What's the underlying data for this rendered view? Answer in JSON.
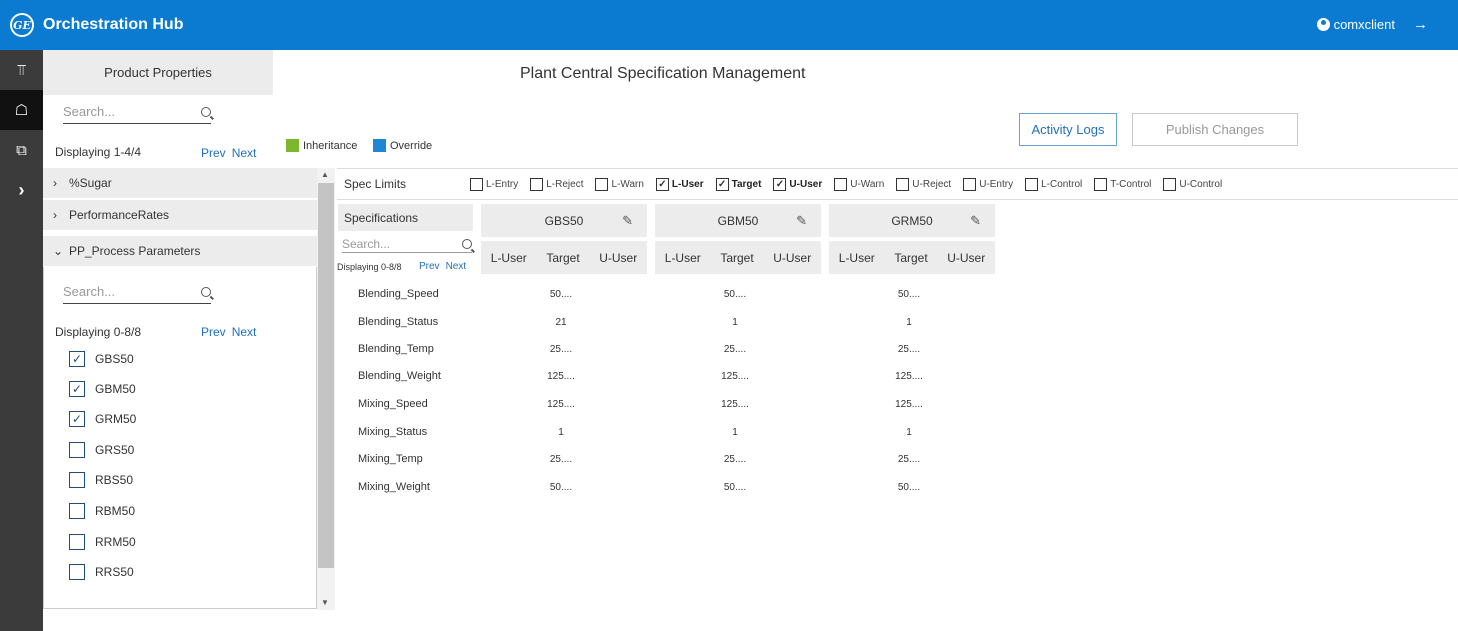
{
  "app": {
    "logo": "GE",
    "title": "Orchestration Hub",
    "user": "comxclient"
  },
  "rail": [
    "hierarchy-icon",
    "factory-icon",
    "grid-icon",
    "chevron-right-icon"
  ],
  "left_panel": {
    "header": "Product Properties",
    "search_placeholder": "Search...",
    "displaying": "Displaying 1-4/4",
    "prev": "Prev",
    "next": "Next",
    "accordion": [
      "%Sugar",
      "PerformanceRates",
      "PP_Process Parameters"
    ],
    "inner_search_placeholder": "Search...",
    "inner_displaying": "Displaying 0-8/8",
    "items": [
      {
        "label": "GBS50",
        "checked": true
      },
      {
        "label": "GBM50",
        "checked": true
      },
      {
        "label": "GRM50",
        "checked": true
      },
      {
        "label": "GRS50",
        "checked": false
      },
      {
        "label": "RBS50",
        "checked": false
      },
      {
        "label": "RBM50",
        "checked": false
      },
      {
        "label": "RRM50",
        "checked": false
      },
      {
        "label": "RRS50",
        "checked": false
      }
    ]
  },
  "main": {
    "title": "Plant Central Specification Management",
    "activity_logs": "Activity Logs",
    "publish_changes": "Publish Changes",
    "legend": [
      {
        "label": "Inheritance",
        "color": "#7cb82f"
      },
      {
        "label": "Override",
        "color": "#1f86d3"
      }
    ],
    "spec_limits_label": "Spec Limits",
    "spec_limits": [
      {
        "label": "L-Entry",
        "checked": false
      },
      {
        "label": "L-Reject",
        "checked": false
      },
      {
        "label": "L-Warn",
        "checked": false
      },
      {
        "label": "L-User",
        "checked": true
      },
      {
        "label": "Target",
        "checked": true
      },
      {
        "label": "U-User",
        "checked": true
      },
      {
        "label": "U-Warn",
        "checked": false
      },
      {
        "label": "U-Reject",
        "checked": false
      },
      {
        "label": "U-Entry",
        "checked": false
      },
      {
        "label": "L-Control",
        "checked": false
      },
      {
        "label": "T-Control",
        "checked": false
      },
      {
        "label": "U-Control",
        "checked": false
      }
    ],
    "specs_header": "Specifications",
    "specs_search_placeholder": "Search...",
    "specs_displaying": "Displaying 0-8/8",
    "specs_prev": "Prev",
    "specs_next": "Next",
    "columns": [
      "GBS50",
      "GBM50",
      "GRM50"
    ],
    "sub_columns": [
      "L-User",
      "Target",
      "U-User"
    ],
    "rows": [
      {
        "name": "Blending_Speed",
        "values": [
          "50....",
          "50....",
          "50...."
        ]
      },
      {
        "name": "Blending_Status",
        "values": [
          "21",
          "1",
          "1"
        ]
      },
      {
        "name": "Blending_Temp",
        "values": [
          "25....",
          "25....",
          "25...."
        ]
      },
      {
        "name": "Blending_Weight",
        "values": [
          "125....",
          "125....",
          "125...."
        ]
      },
      {
        "name": "Mixing_Speed",
        "values": [
          "125....",
          "125....",
          "125...."
        ]
      },
      {
        "name": "Mixing_Status",
        "values": [
          "1",
          "1",
          "1"
        ]
      },
      {
        "name": "Mixing_Temp",
        "values": [
          "25....",
          "25....",
          "25...."
        ]
      },
      {
        "name": "Mixing_Weight",
        "values": [
          "50....",
          "50....",
          "50...."
        ]
      }
    ]
  }
}
